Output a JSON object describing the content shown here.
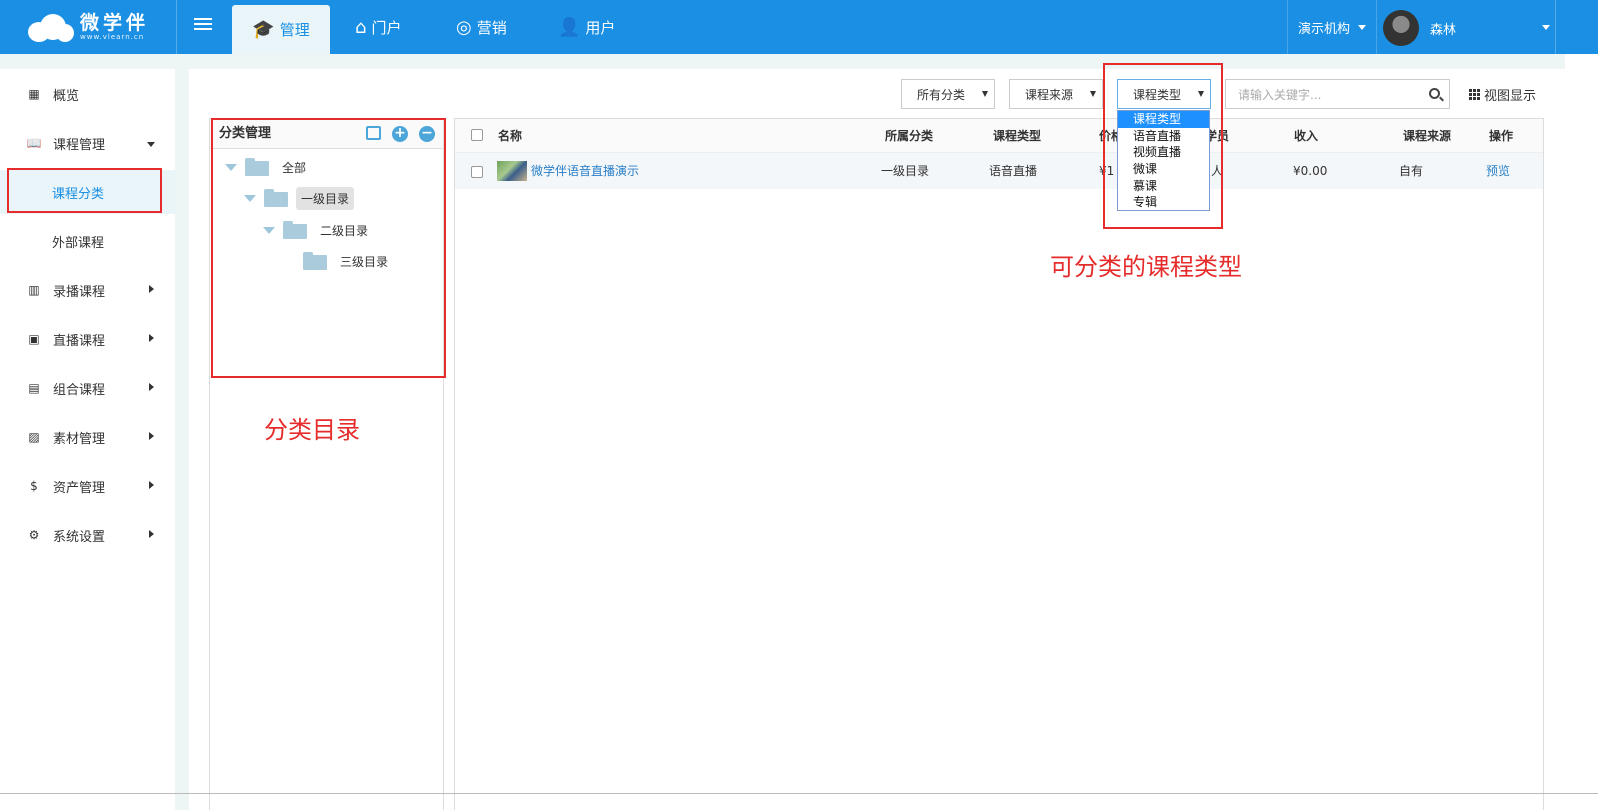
{
  "brand": {
    "name": "微学伴",
    "sub": "www.vlearn.cn"
  },
  "topnav": [
    {
      "label": "管理",
      "icon": "graduation-cap-icon",
      "active": true
    },
    {
      "label": "门户",
      "icon": "home-icon"
    },
    {
      "label": "营销",
      "icon": "spinner-icon"
    },
    {
      "label": "用户",
      "icon": "user-gear-icon"
    }
  ],
  "org": "演示机构",
  "user": {
    "name": "森林"
  },
  "sidebar": {
    "items": [
      {
        "label": "概览",
        "icon": "grid-icon"
      },
      {
        "label": "课程管理",
        "icon": "book-icon",
        "expanded": true
      },
      {
        "label": "课程分类",
        "sub": true,
        "active": true
      },
      {
        "label": "外部课程",
        "sub": true
      },
      {
        "label": "录播课程",
        "icon": "building-icon"
      },
      {
        "label": "直播课程",
        "icon": "presentation-icon"
      },
      {
        "label": "组合课程",
        "icon": "bar-chart-icon"
      },
      {
        "label": "素材管理",
        "icon": "image-icon"
      },
      {
        "label": "资产管理",
        "icon": "dollar-circle-icon"
      },
      {
        "label": "系统设置",
        "icon": "gear-icon"
      }
    ]
  },
  "filters": {
    "category": "所有分类",
    "source": "课程来源",
    "type": "课程类型",
    "search_placeholder": "请输入关键字...",
    "view_label": "视图显示"
  },
  "type_options": [
    "课程类型",
    "语音直播",
    "视频直播",
    "微课",
    "慕课",
    "专辑"
  ],
  "tree": {
    "title": "分类管理",
    "nodes": [
      {
        "label": "全部",
        "level": 0
      },
      {
        "label": "一级目录",
        "level": 1,
        "highlight": true
      },
      {
        "label": "二级目录",
        "level": 2
      },
      {
        "label": "三级目录",
        "level": 3
      }
    ]
  },
  "table": {
    "columns": [
      "名称",
      "所属分类",
      "课程类型",
      "价格",
      "学员",
      "收入",
      "课程来源",
      "操作"
    ],
    "rows": [
      {
        "name": "微学伴语音直播演示",
        "category": "一级目录",
        "type": "语音直播",
        "price": "¥1",
        "students": "人",
        "income": "¥0.00",
        "source": "自有",
        "action": "预览"
      }
    ]
  },
  "annotations": {
    "tree_note": "分类目录",
    "type_note": "可分类的课程类型"
  },
  "colors": {
    "brand": "#1a8fe3",
    "annotation": "#e62b2b"
  }
}
